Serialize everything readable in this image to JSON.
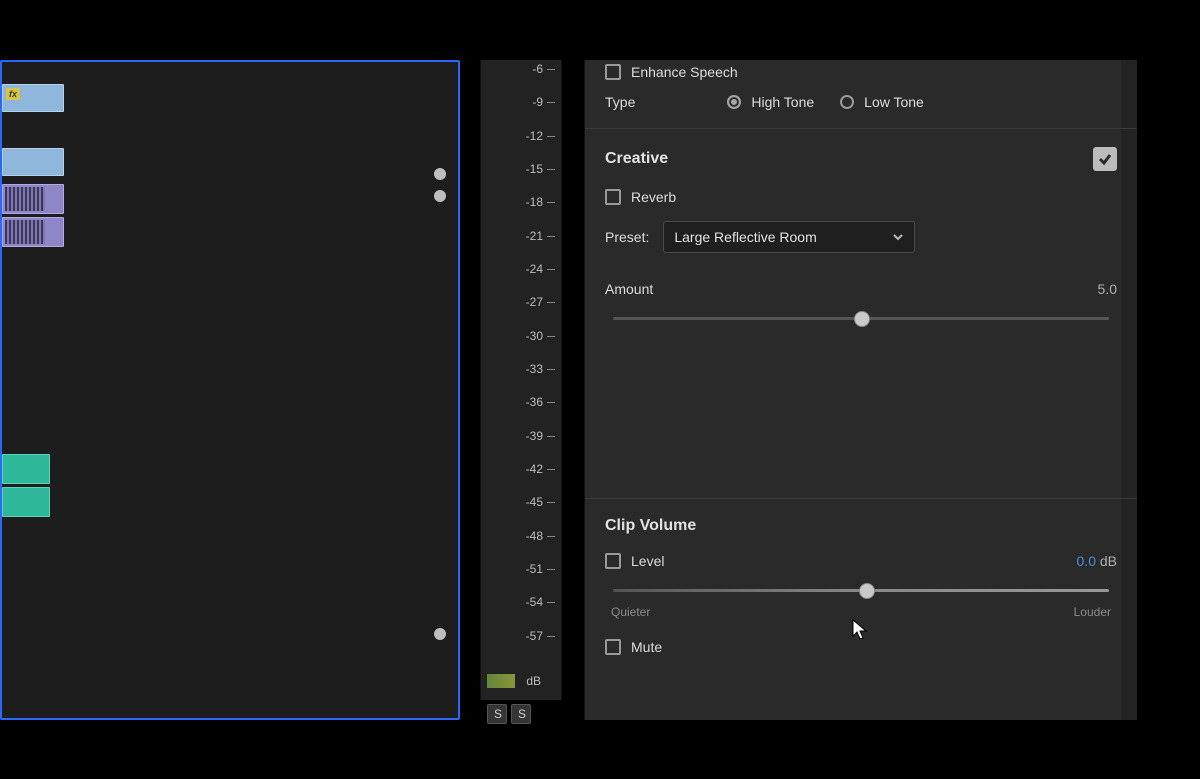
{
  "meter": {
    "ticks_db": [
      -6,
      -9,
      -12,
      -15,
      -18,
      -21,
      -24,
      -27,
      -30,
      -33,
      -36,
      -39,
      -42,
      -45,
      -48,
      -51,
      -54,
      -57
    ],
    "unit_label": "dB",
    "solo_buttons": [
      "S",
      "S"
    ]
  },
  "timeline": {
    "keyframes_y": [
      108,
      130,
      568
    ]
  },
  "panel": {
    "enhance_speech": {
      "label": "Enhance Speech",
      "checked": false
    },
    "type": {
      "label": "Type",
      "options": [
        {
          "label": "High Tone",
          "selected": true
        },
        {
          "label": "Low Tone",
          "selected": false
        }
      ]
    },
    "creative": {
      "title": "Creative",
      "enabled": true,
      "reverb": {
        "label": "Reverb",
        "checked": false
      },
      "preset": {
        "label": "Preset:",
        "value": "Large Reflective Room"
      },
      "amount": {
        "label": "Amount",
        "value": "5.0",
        "pos_pct": 50
      }
    },
    "clip_volume": {
      "title": "Clip Volume",
      "level": {
        "label": "Level",
        "checked": false,
        "value": "0.0",
        "unit": "dB",
        "pos_pct": 51
      },
      "quieter_label": "Quieter",
      "louder_label": "Louder",
      "mute": {
        "label": "Mute",
        "checked": false
      }
    }
  }
}
